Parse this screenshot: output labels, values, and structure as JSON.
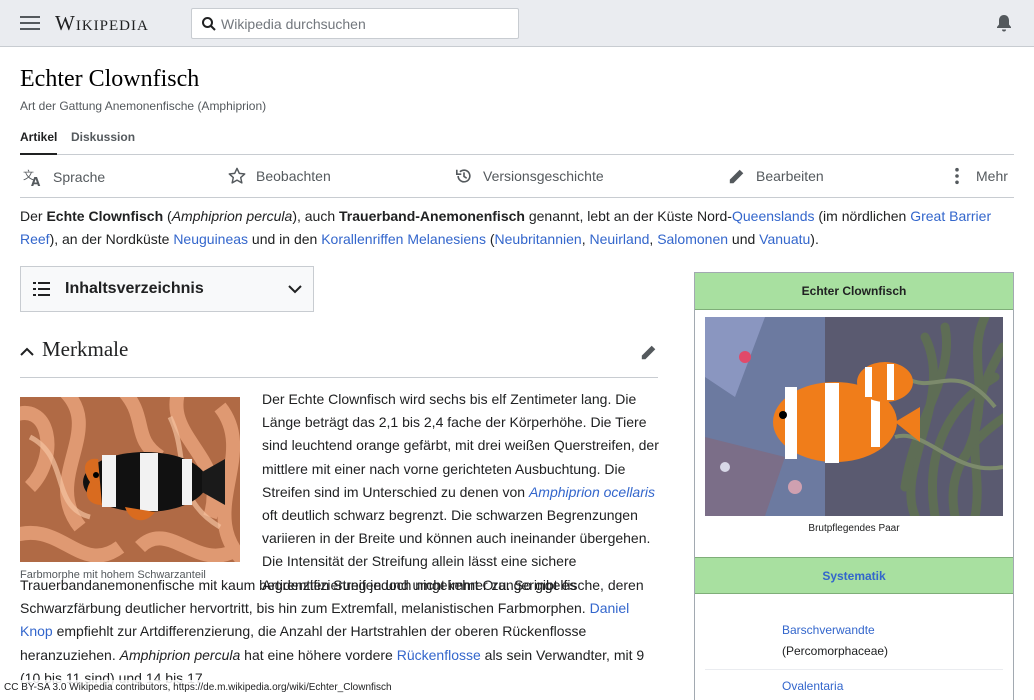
{
  "header": {
    "wordmark": "Wikipedia",
    "search_placeholder": "Wikipedia durchsuchen"
  },
  "page": {
    "title": "Echter Clownfisch",
    "tagline": "Art der Gattung Anemonenfische (Amphiprion)"
  },
  "tabs": [
    {
      "label": "Artikel",
      "active": true
    },
    {
      "label": "Diskussion",
      "active": false
    }
  ],
  "actions": {
    "language": "Sprache",
    "watch": "Beobachten",
    "history": "Versionsgeschichte",
    "edit": "Bearbeiten",
    "more": "Mehr"
  },
  "lead": {
    "t1": "Der ",
    "b1": "Echte Clownfisch",
    "t2": " (",
    "i1": "Amphiprion percula",
    "t3": "), auch ",
    "b2": "Trauerband-Anemonenfisch",
    "t4": " genannt, lebt an der Küste Nord-",
    "l1": "Queenslands",
    "t5": " (im nördlichen ",
    "l2": "Great Barrier Reef",
    "t6": "), an der Nordküste ",
    "l3": "Neuguineas",
    "t7": " und in den ",
    "l4": "Korallenriffen Melanesiens",
    "t8": " (",
    "l5": "Neubritannien",
    "t9": ", ",
    "l6": "Neuirland",
    "t10": ", ",
    "l7": "Salomonen",
    "t11": " und ",
    "l8": "Vanuatu",
    "t12": ")."
  },
  "toc": {
    "label": "Inhaltsverzeichnis"
  },
  "section": {
    "title": "Merkmale",
    "thumb_caption": "Farbmorphe mit hohem Schwarzanteil",
    "p1a": "Der Echte Clownfisch wird sechs bis elf Zentimeter lang. Die Länge beträgt das 2,1 bis 2,4 fache der Körperhöhe. Die Tiere sind leuchtend orange gefärbt, mit drei weißen Querstreifen, der mittlere mit einer nach vorne gerichteten Ausbuchtung. Die Streifen sind im Unterschied zu denen von ",
    "p1_link": "Amphiprion ocellaris",
    "p1b": " oft deutlich schwarz begrenzt. Die schwarzen Begrenzungen variieren in der Breite und können auch ineinander übergehen. Die Intensität der Streifung allein lässt eine sichere Artidentifizierung jedoch nicht immer zu. So gibt es",
    "p2a": "Trauerbandanemonenfische mit kaum begrenzten Streifen und umgekehrt Orangeringelfische, deren Schwarzfärbung deutlicher hervortritt, bis hin zum Extremfall, melanistischen Farbmorphen. ",
    "p2_link1": "Daniel Knop",
    "p2b": " empfiehlt zur Artdifferenzierung, die Anzahl der Hartstrahlen der oberen Rückenflosse heranzuziehen. ",
    "p2_italic": "Amphiprion percula",
    "p2c": " hat eine höhere vordere ",
    "p2_link2": "Rückenflosse",
    "p2d": " als sein Verwandter, mit 9 (10 bis 11 sind) und 14 bis 17"
  },
  "infobox": {
    "title": "Echter Clownfisch",
    "image_caption": "Brutpflegendes Paar",
    "systematik": "Systematik",
    "row1_link": "Barschverwandte",
    "row1_sub": "(Percomorphaceae)",
    "row2_link": "Ovalentaria"
  },
  "license": "CC BY-SA 3.0 Wikipedia contributors, https://de.m.wikipedia.org/wiki/Echter_Clownfisch",
  "colors": {
    "link": "#3366cc",
    "header_bg": "#eaecf0",
    "infobox_green": "#a8e0a0"
  }
}
